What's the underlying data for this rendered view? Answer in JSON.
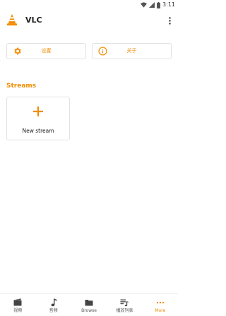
{
  "status_bar": {
    "time": "3:11",
    "icons": [
      "wifi-icon",
      "signal-icon",
      "battery-icon"
    ]
  },
  "app_bar": {
    "title": "VLC",
    "logo": "vlc-cone-logo",
    "menu_icon": "more-vertical-icon"
  },
  "top_buttons": [
    {
      "label": "设置",
      "icon": "gear-icon"
    },
    {
      "label": "关于",
      "icon": "info-icon"
    }
  ],
  "streams": {
    "title": "Streams",
    "new_stream_label": "New stream",
    "new_stream_icon": "plus-icon"
  },
  "bottom_nav": {
    "active_index": 4,
    "items": [
      {
        "label": "视频",
        "icon": "video-icon"
      },
      {
        "label": "音频",
        "icon": "music-note-icon"
      },
      {
        "label": "Browse",
        "icon": "folder-icon"
      },
      {
        "label": "播放列表",
        "icon": "playlist-icon"
      },
      {
        "label": "More",
        "icon": "more-horizontal-icon"
      }
    ]
  },
  "colors": {
    "accent": "#ef8d00",
    "text": "#212121",
    "border": "#e2e2e2",
    "nav_icon": "#444444"
  }
}
